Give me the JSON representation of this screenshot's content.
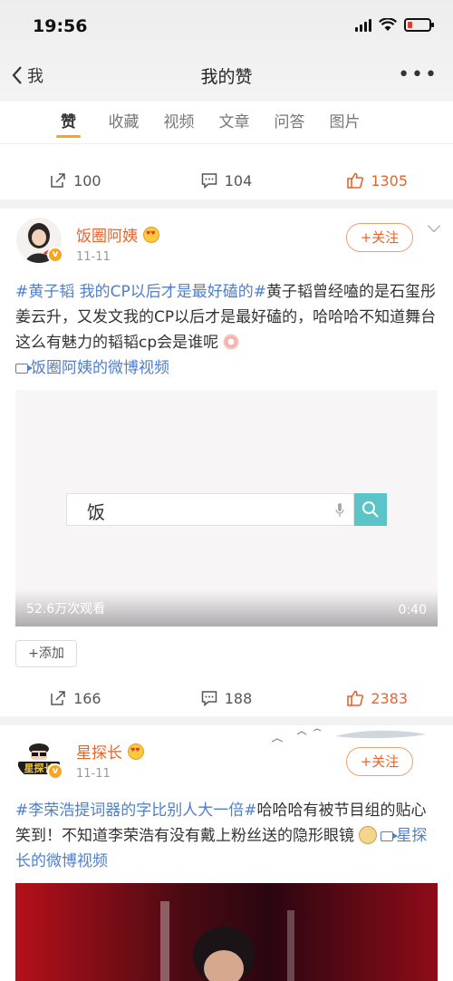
{
  "status": {
    "time": "19:56"
  },
  "nav": {
    "back_label": "我",
    "title": "我的赞",
    "more": "•••"
  },
  "tabs": [
    "赞",
    "收藏",
    "视频",
    "文章",
    "问答",
    "图片"
  ],
  "post0": {
    "actions": {
      "repost": "100",
      "comment": "104",
      "like": "1305"
    }
  },
  "post1": {
    "username": "饭圈阿姨",
    "date": "11-11",
    "follow_label": "+关注",
    "text": {
      "tag": "#黄子韬 我的CP以后才是最好磕的#",
      "body": "黄子韬曾经嗑的是石玺彤姜云升，又发文我的CP以后才是最好磕的，哈哈哈不知道舞台这么有魅力的韬韬cp会是谁呢",
      "video_link": "饭圈阿姨的微博视频"
    },
    "video": {
      "search_text": "饭",
      "views": "52.6万次观看",
      "duration": "0:40"
    },
    "add_label": "+添加",
    "actions": {
      "repost": "166",
      "comment": "188",
      "like": "2383"
    }
  },
  "post2": {
    "username": "星探长",
    "date": "11-11",
    "follow_label": "+关注",
    "avatar_text": "星探长",
    "text": {
      "tag": "#李荣浩提词器的字比别人大一倍#",
      "body": "哈哈哈有被节目组的贴心笑到！不知道李荣浩有没有戴上粉丝送的隐形眼镜",
      "video_link": "星探长的微博视频"
    }
  },
  "colors": {
    "accent": "#e8642c",
    "link": "#4f7fc8",
    "tab_indicator": "#f6a623",
    "search_button": "#5bc4c9"
  }
}
